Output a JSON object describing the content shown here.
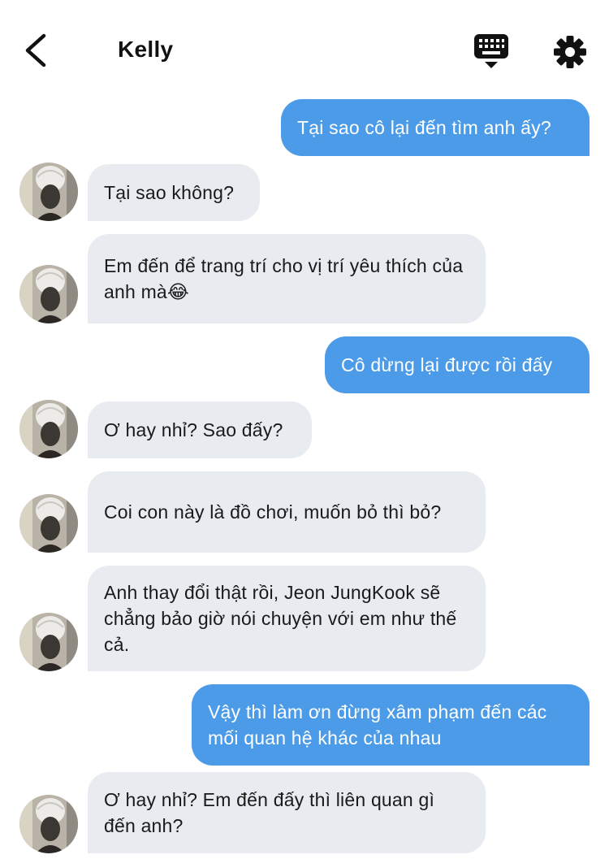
{
  "header": {
    "title": "Kelly",
    "back_icon": "chevron-left-icon",
    "keyboard_icon": "keyboard-icon",
    "settings_icon": "gear-icon"
  },
  "colors": {
    "outgoing_bubble": "#4c9be8",
    "incoming_bubble": "#e8ebef",
    "background": "#ffffff"
  },
  "messages": [
    {
      "direction": "out",
      "text": "Tại sao cô lại đến tìm anh ấy?"
    },
    {
      "direction": "in",
      "text": "Tại sao không?"
    },
    {
      "direction": "in",
      "text": "Em đến để trang trí cho vị trí yêu thích của anh mà😂"
    },
    {
      "direction": "out",
      "text": "Cô dừng lại được rồi đấy"
    },
    {
      "direction": "in",
      "text": "Ơ hay nhỉ? Sao đấy?"
    },
    {
      "direction": "in",
      "text": "Coi con này là đồ chơi, muốn bỏ thì bỏ?"
    },
    {
      "direction": "in",
      "text": "Anh thay đổi thật rồi, Jeon JungKook sẽ chẳng bảo giờ nói chuyện với em như thế cả."
    },
    {
      "direction": "out",
      "text": "Vậy thì làm ơn đừng xâm phạm đến các mối quan hệ khác của nhau"
    },
    {
      "direction": "in",
      "text": "Ơ hay nhỉ? Em đến đấy thì liên quan gì đến anh?"
    }
  ]
}
